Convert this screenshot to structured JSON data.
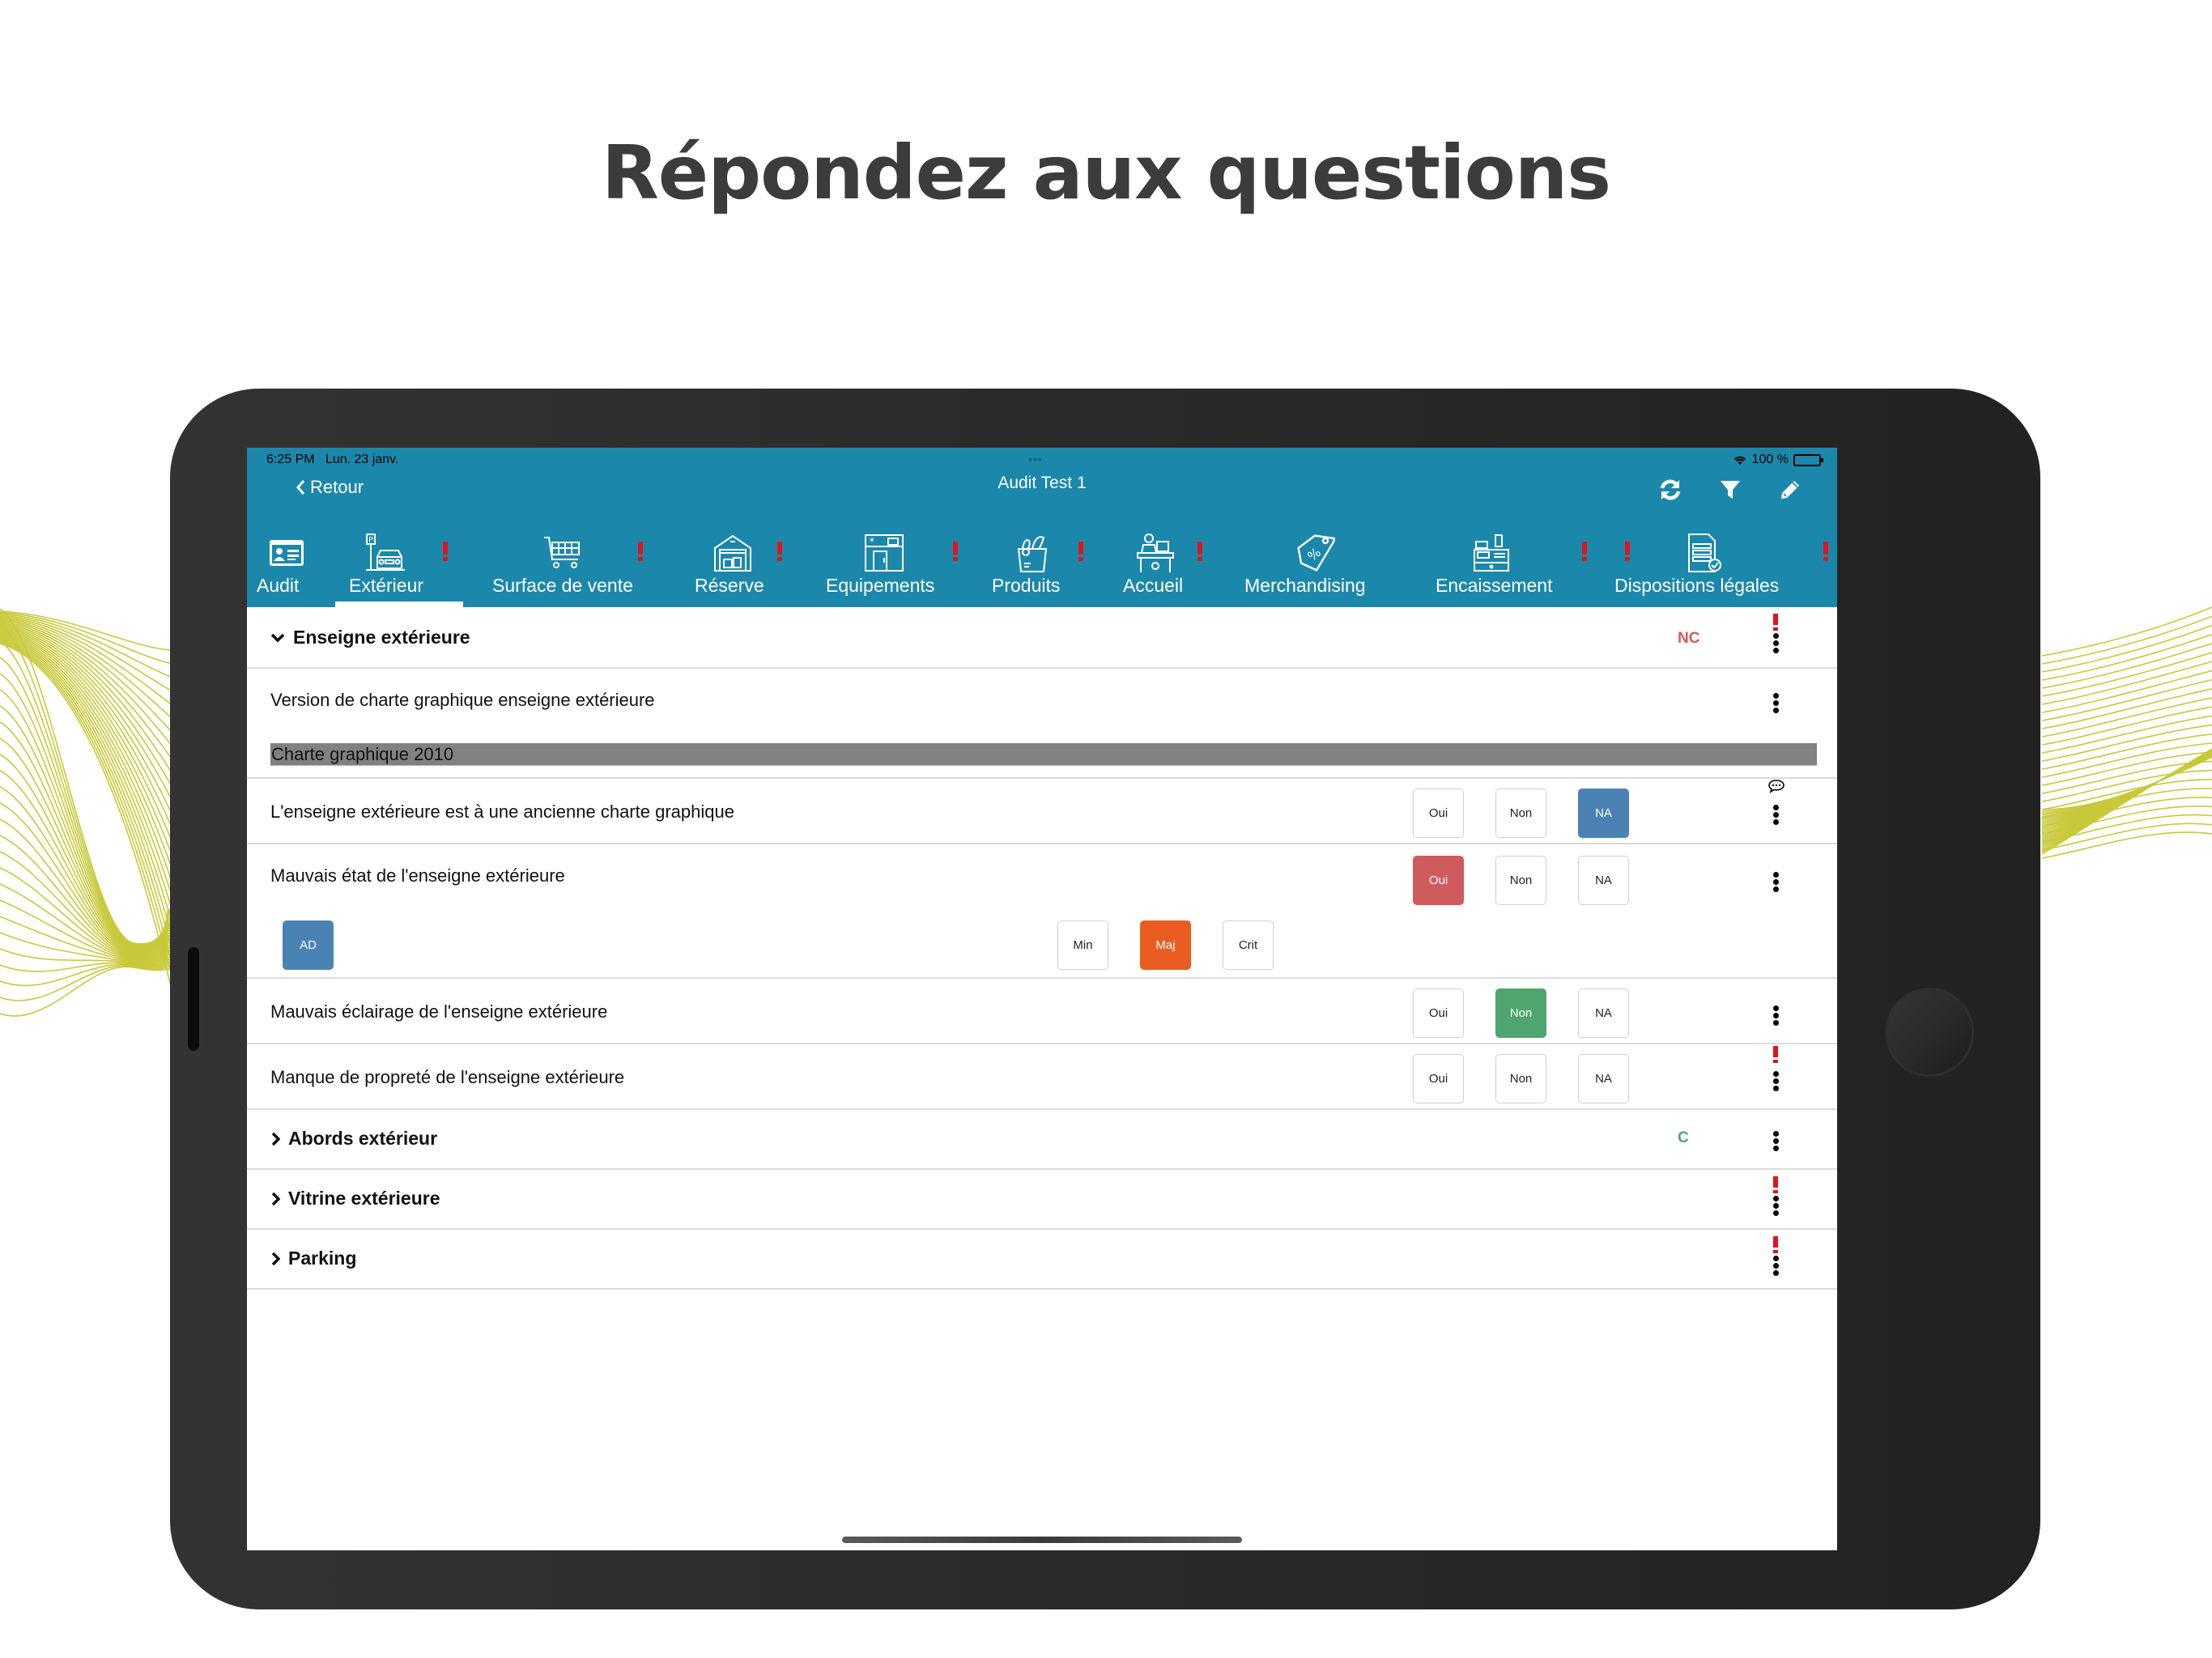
{
  "headline": "Répondez aux questions",
  "status_bar": {
    "time": "6:25 PM",
    "date": "Lun. 23 janv.",
    "multitask_dots": "•••",
    "battery_text": "100 %"
  },
  "nav": {
    "back_label": "Retour",
    "title": "Audit Test 1",
    "actions": [
      "refresh-icon",
      "filter-icon",
      "edit-icon"
    ]
  },
  "tabs": [
    {
      "label": "Audit",
      "icon": "id-card-icon",
      "alert": false,
      "active": false
    },
    {
      "label": "Extérieur",
      "icon": "parking-car-icon",
      "alert": true,
      "active": true
    },
    {
      "label": "Surface de vente",
      "icon": "shopping-cart-icon",
      "alert": true,
      "active": false
    },
    {
      "label": "Réserve",
      "icon": "warehouse-icon",
      "alert": true,
      "active": false
    },
    {
      "label": "Equipements",
      "icon": "fridge-icon",
      "alert": true,
      "active": false
    },
    {
      "label": "Produits",
      "icon": "grocery-bag-icon",
      "alert": true,
      "active": false
    },
    {
      "label": "Accueil",
      "icon": "reception-desk-icon",
      "alert": true,
      "active": false
    },
    {
      "label": "Merchandising",
      "icon": "discount-tag-icon",
      "alert": true,
      "active": false
    },
    {
      "label": "Encaissement",
      "icon": "cash-register-icon",
      "alert": true,
      "active": false
    },
    {
      "label": "Dispositions légales",
      "icon": "legal-document-icon",
      "alert": true,
      "active": false
    }
  ],
  "sections": {
    "enseigne": {
      "title": "Enseigne extérieure",
      "expanded": true,
      "status": "NC",
      "status_color": "#d05b5c",
      "alert": true
    },
    "abords": {
      "title": "Abords extérieur",
      "expanded": false,
      "status": "C",
      "status_color": "#4ea66e",
      "alert": false
    },
    "vitrine": {
      "title": "Vitrine extérieure",
      "expanded": false,
      "status": "",
      "alert": true
    },
    "parking": {
      "title": "Parking",
      "expanded": false,
      "status": "",
      "alert": true
    }
  },
  "questions": {
    "version": {
      "text": "Version de charte graphique enseigne extérieure",
      "selected_value": "Charte graphique 2010"
    },
    "ancienne": {
      "text": "L'enseigne extérieure est à une ancienne charte graphique",
      "options": [
        "Oui",
        "Non",
        "NA"
      ],
      "selected": "NA",
      "has_comment": true
    },
    "mauvais_etat": {
      "text": "Mauvais état de l'enseigne extérieure",
      "options": [
        "Oui",
        "Non",
        "NA"
      ],
      "selected": "Oui",
      "action_label": "AD",
      "severity_options": [
        "Min",
        "Maj",
        "Crit"
      ],
      "severity_selected": "Maj"
    },
    "eclairage": {
      "text": "Mauvais éclairage de l'enseigne extérieure",
      "options": [
        "Oui",
        "Non",
        "NA"
      ],
      "selected": "Non"
    },
    "proprete": {
      "text": "Manque de propreté de l'enseigne extérieure",
      "options": [
        "Oui",
        "Non",
        "NA"
      ],
      "selected": null,
      "alert": true
    }
  },
  "colors": {
    "header": "#1b88ab",
    "alert": "#e3131b",
    "answer_yes_bad": "#d05b5c",
    "answer_no_good": "#4ea66e",
    "answer_na": "#4a83b3",
    "severity_major": "#e95d21",
    "wave_lines": "#c8c93a"
  }
}
